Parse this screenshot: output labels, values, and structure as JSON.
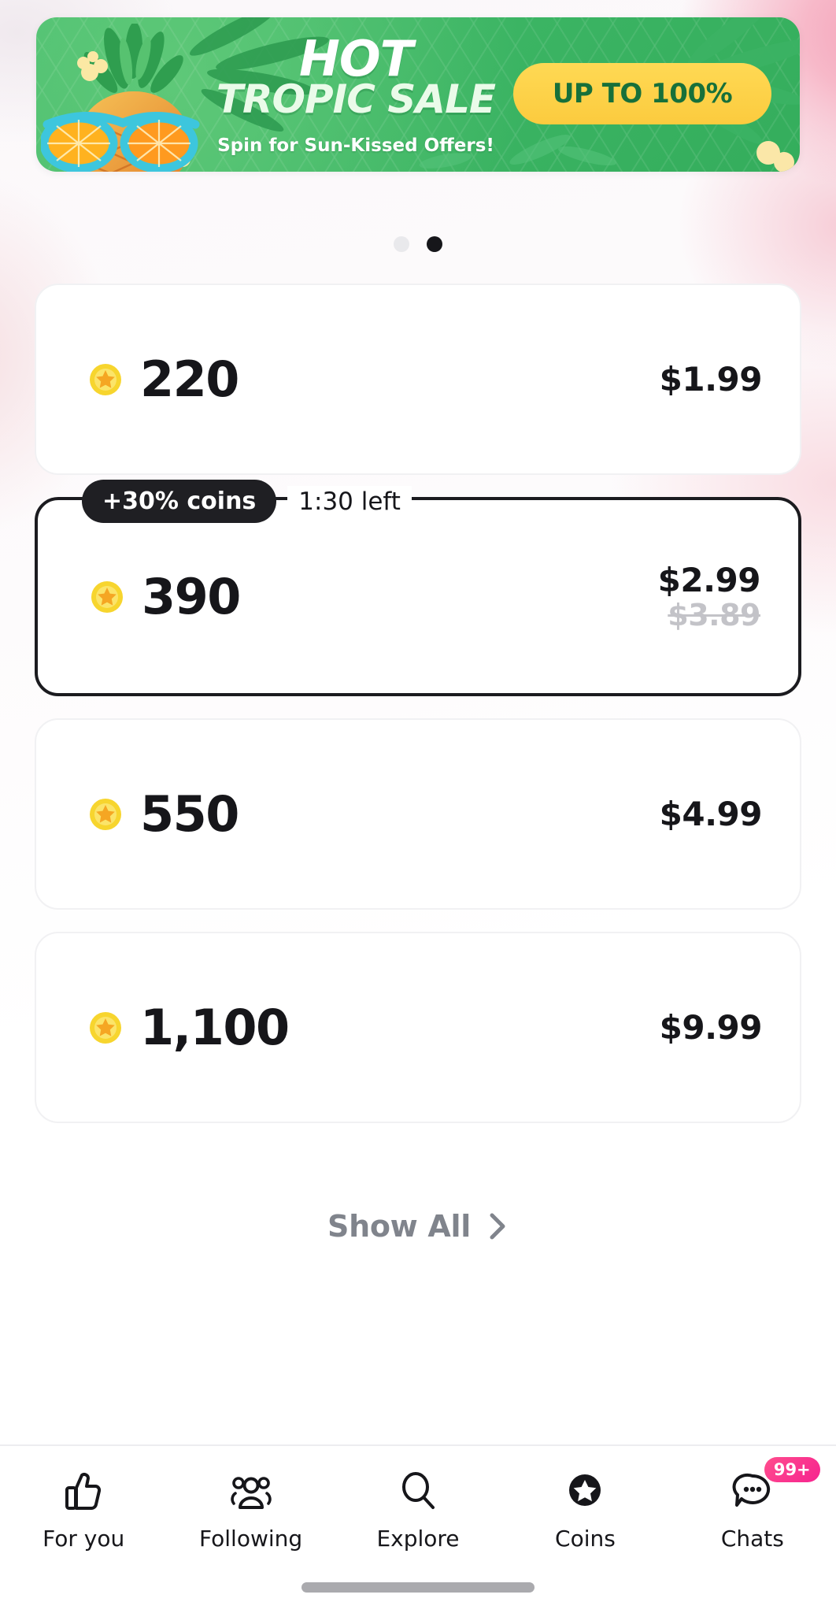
{
  "banner": {
    "title_line1": "HOT",
    "title_line2": "TROPIC SALE",
    "subtitle": "Spin for Sun-Kissed Offers!",
    "pill_label": "UP TO 100%",
    "green": "#3cb564",
    "pill_yellow": "#fbcb3e",
    "pill_text_color": "#17703a"
  },
  "carousel": {
    "dots": [
      {
        "name": "dot-1",
        "active": false
      },
      {
        "name": "dot-2",
        "active": true
      }
    ]
  },
  "packages": [
    {
      "coins": "220",
      "price": "$1.99",
      "price_old": "",
      "promo_badge": "",
      "promo_timer": "",
      "selected": false
    },
    {
      "coins": "390",
      "price": "$2.99",
      "price_old": "$3.89",
      "promo_badge": "+30% coins",
      "promo_timer": "1:30 left",
      "selected": true
    },
    {
      "coins": "550",
      "price": "$4.99",
      "price_old": "",
      "promo_badge": "",
      "promo_timer": "",
      "selected": false
    },
    {
      "coins": "1,100",
      "price": "$9.99",
      "price_old": "",
      "promo_badge": "",
      "promo_timer": "",
      "selected": false
    }
  ],
  "show_all": {
    "label": "Show All",
    "chevron_icon": "chevron-right-icon"
  },
  "tabbar": {
    "items": [
      {
        "label": "For you",
        "icon": "thumbs-up-icon",
        "badge": ""
      },
      {
        "label": "Following",
        "icon": "people-icon",
        "badge": ""
      },
      {
        "label": "Explore",
        "icon": "search-icon",
        "badge": ""
      },
      {
        "label": "Coins",
        "icon": "star-coin-icon",
        "badge": ""
      },
      {
        "label": "Chats",
        "icon": "chat-bubble-icon",
        "badge": "99+"
      }
    ],
    "badge_color": "#f6238f"
  },
  "coin_icon": {
    "name": "coin-star-icon",
    "outer_color": "#f7d52e",
    "star_color": "#f5a623"
  }
}
